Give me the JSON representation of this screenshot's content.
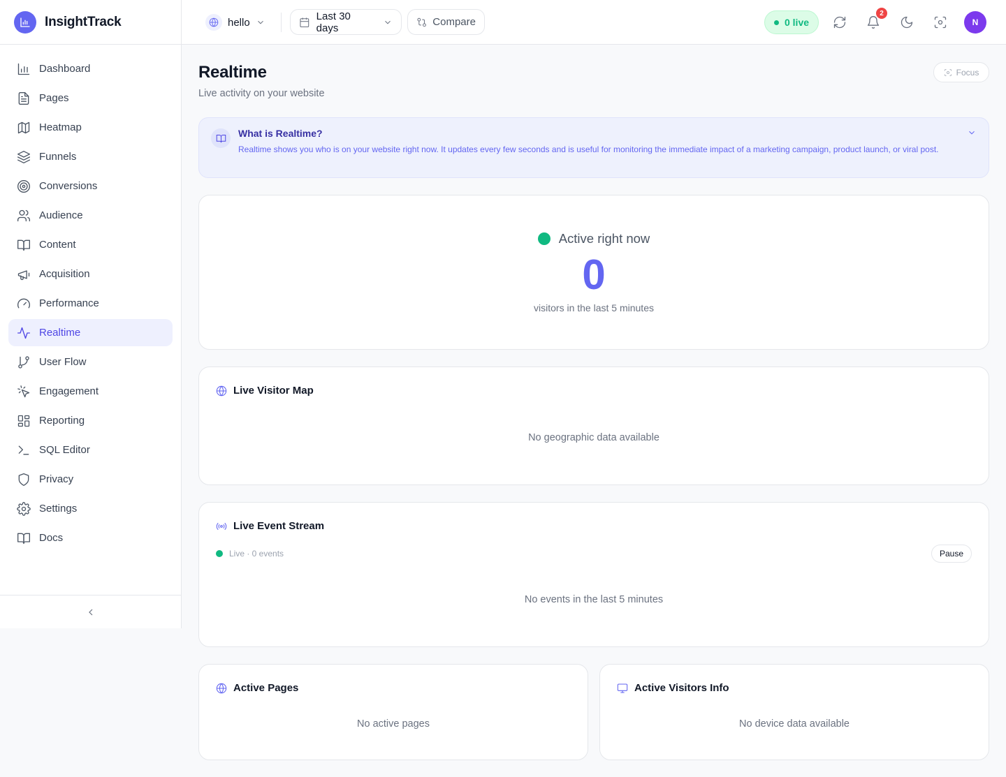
{
  "brand": {
    "name": "InsightTrack"
  },
  "sidebar": {
    "items": [
      {
        "label": "Dashboard",
        "icon": "bar-chart-icon",
        "active": false
      },
      {
        "label": "Pages",
        "icon": "file-text-icon",
        "active": false
      },
      {
        "label": "Heatmap",
        "icon": "map-icon",
        "active": false
      },
      {
        "label": "Funnels",
        "icon": "layers-icon",
        "active": false
      },
      {
        "label": "Conversions",
        "icon": "target-icon",
        "active": false
      },
      {
        "label": "Audience",
        "icon": "users-icon",
        "active": false
      },
      {
        "label": "Content",
        "icon": "book-open-icon",
        "active": false
      },
      {
        "label": "Acquisition",
        "icon": "megaphone-icon",
        "active": false
      },
      {
        "label": "Performance",
        "icon": "gauge-icon",
        "active": false
      },
      {
        "label": "Realtime",
        "icon": "activity-icon",
        "active": true
      },
      {
        "label": "User Flow",
        "icon": "git-branch-icon",
        "active": false
      },
      {
        "label": "Engagement",
        "icon": "pointer-click-icon",
        "active": false
      },
      {
        "label": "Reporting",
        "icon": "layout-dashboard-icon",
        "active": false
      },
      {
        "label": "SQL Editor",
        "icon": "terminal-icon",
        "active": false
      },
      {
        "label": "Privacy",
        "icon": "shield-icon",
        "active": false
      },
      {
        "label": "Settings",
        "icon": "gear-icon",
        "active": false
      },
      {
        "label": "Docs",
        "icon": "book-icon",
        "active": false
      }
    ],
    "collapse_icon": "chevron-left-icon"
  },
  "header": {
    "site": "hello",
    "date_range": "Last 30 days",
    "compare_label": "Compare",
    "live_label": "0 live",
    "notification_count": "2",
    "avatar_initial": "N"
  },
  "page": {
    "title": "Realtime",
    "subtitle": "Live activity on your website",
    "focus_label": "Focus"
  },
  "info": {
    "title": "What is Realtime?",
    "text": "Realtime shows you who is on your website right now. It updates every few seconds and is useful for monitoring the immediate impact of a marketing campaign, product launch, or viral post."
  },
  "active": {
    "label": "Active right now",
    "count": "0",
    "sub": "visitors in the last 5 minutes"
  },
  "map": {
    "title": "Live Visitor Map",
    "empty": "No geographic data available"
  },
  "stream": {
    "title": "Live Event Stream",
    "status": "Live · 0 events",
    "pause_label": "Pause",
    "empty": "No events in the last 5 minutes"
  },
  "active_pages": {
    "title": "Active Pages",
    "empty": "No active pages"
  },
  "visitors_info": {
    "title": "Active Visitors Info",
    "empty": "No device data available"
  },
  "colors": {
    "accent": "#6366f1",
    "live_green": "#10b981",
    "badge_red": "#ef4444",
    "avatar": "#7c3aed"
  }
}
